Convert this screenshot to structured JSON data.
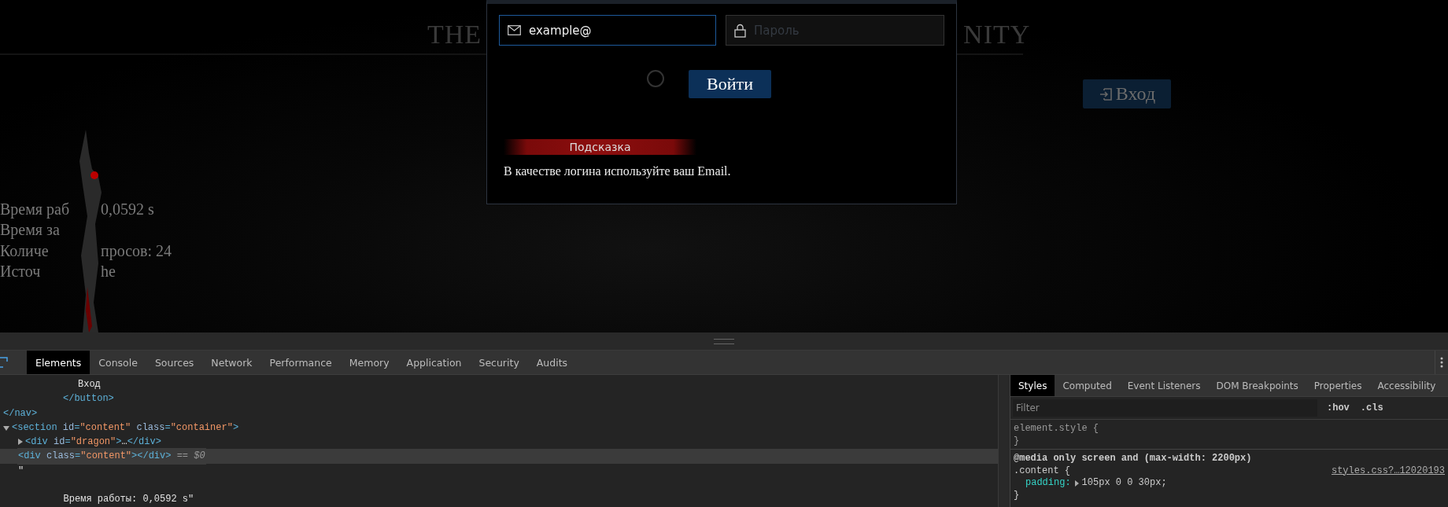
{
  "page": {
    "title_fragments": [
      "THE",
      "NITY"
    ],
    "nav_button": {
      "label": "Вход"
    },
    "stats": [
      {
        "parts": [
          "Время раб",
          "0,0592 s"
        ]
      },
      {
        "parts": [
          "Время за"
        ]
      },
      {
        "parts": [
          "Количе",
          "просов: 24"
        ]
      },
      {
        "parts": [
          "Источ",
          "he"
        ]
      }
    ]
  },
  "login_modal": {
    "email": {
      "value": "example@"
    },
    "password": {
      "placeholder": "Пароль"
    },
    "loading": true,
    "submit": {
      "label": "Войти"
    },
    "hint": {
      "title": "Подсказка",
      "text": "В качестве логина используйте ваш Email."
    }
  },
  "devtools": {
    "tabs": [
      {
        "label": "Elements",
        "selected": true
      },
      {
        "label": "Console",
        "selected": false
      },
      {
        "label": "Sources",
        "selected": false
      },
      {
        "label": "Network",
        "selected": false
      },
      {
        "label": "Performance",
        "selected": false
      },
      {
        "label": "Memory",
        "selected": false
      },
      {
        "label": "Application",
        "selected": false
      },
      {
        "label": "Security",
        "selected": false
      },
      {
        "label": "Audits",
        "selected": false
      }
    ],
    "dom_tree": [
      {
        "selected": false,
        "closing": [
          {
            "kind": "tag",
            "text": "</nav>"
          }
        ],
        "children": [
          {
            "children": [
              {
                "children": [
                  {
                    "children": [
                      {
                        "selected": false,
                        "closing": [
                          {
                            "kind": "tag",
                            "text": "</button>"
                          }
                        ],
                        "children": [
                          {
                            "selected": false,
                            "segments": [
                              {
                                "kind": "text",
                                "text": "Вход"
                              }
                            ]
                          }
                        ]
                      }
                    ]
                  }
                ]
              }
            ]
          }
        ]
      },
      {
        "selected": false,
        "expanded": true,
        "segments": [
          {
            "kind": "tag",
            "text": "<section"
          },
          {
            "kind": "attr",
            "text": " id"
          },
          {
            "kind": "tag",
            "text": "="
          },
          {
            "kind": "value",
            "text": "\"content\""
          },
          {
            "kind": "attr",
            "text": " class"
          },
          {
            "kind": "tag",
            "text": "="
          },
          {
            "kind": "value",
            "text": "\"container\""
          },
          {
            "kind": "tag",
            "text": ">"
          }
        ],
        "children": [
          {
            "selected": false,
            "expanded": false,
            "segments": [
              {
                "kind": "tag",
                "text": "<div"
              },
              {
                "kind": "attr",
                "text": " id"
              },
              {
                "kind": "tag",
                "text": "="
              },
              {
                "kind": "value",
                "text": "\"dragon\""
              },
              {
                "kind": "tag",
                "text": ">"
              },
              {
                "kind": "text",
                "text": "…"
              },
              {
                "kind": "tag",
                "text": "</div>"
              }
            ]
          },
          {
            "selected": true,
            "segments": [
              {
                "kind": "tag",
                "text": "<div"
              },
              {
                "kind": "attr",
                "text": " class"
              },
              {
                "kind": "tag",
                "text": "="
              },
              {
                "kind": "value",
                "text": "\"content\""
              },
              {
                "kind": "tag",
                "text": "></div>"
              },
              {
                "kind": "hint",
                "text": " == $0"
              }
            ]
          },
          {
            "selected": false,
            "segments": [
              {
                "kind": "text",
                "text": "\"\n\n        Время работы: 0,0592 s\""
              }
            ]
          }
        ]
      }
    ],
    "styles_pane": {
      "tabs": [
        {
          "label": "Styles",
          "selected": true
        },
        {
          "label": "Computed",
          "selected": false
        },
        {
          "label": "Event Listeners",
          "selected": false
        },
        {
          "label": "DOM Breakpoints",
          "selected": false
        },
        {
          "label": "Properties",
          "selected": false
        },
        {
          "label": "Accessibility",
          "selected": false
        }
      ],
      "filter": {
        "placeholder": "Filter"
      },
      "toggles": [
        ":hov",
        ".cls"
      ],
      "rules": [
        {
          "kind": "element",
          "selector": "element.style {",
          "close": "}"
        },
        {
          "kind": "media",
          "media": "@media only screen and (max-width: 2200px)",
          "selector": ".content {",
          "source": "styles.css?…12020193",
          "declarations": [
            {
              "property": "padding:",
              "value": "105px 0 0 30px;",
              "expandable": true
            }
          ],
          "close": "}"
        }
      ]
    }
  }
}
